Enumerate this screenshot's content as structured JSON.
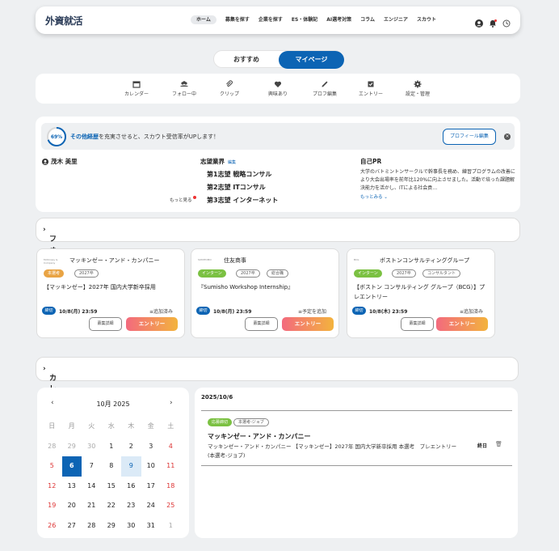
{
  "header": {
    "logo": "外資就活",
    "nav": [
      "ホーム",
      "募集を探す",
      "企業を探す",
      "ES・体験記",
      "AI選考対策",
      "コラム",
      "エンジニア",
      "スカウト"
    ]
  },
  "tabs": [
    "おすすめ",
    "マイページ"
  ],
  "menu": [
    {
      "label": "カレンダー",
      "icon": "calendar-icon"
    },
    {
      "label": "フォロー中",
      "icon": "people-icon"
    },
    {
      "label": "クリップ",
      "icon": "clip-icon"
    },
    {
      "label": "興味あり",
      "icon": "heart-icon"
    },
    {
      "label": "プロフ編集",
      "icon": "pencil-icon"
    },
    {
      "label": "エントリー",
      "icon": "entry-icon"
    },
    {
      "label": "設定・管理",
      "icon": "gear-icon"
    }
  ],
  "profile": {
    "percent": "69%",
    "percent_value": 0.69,
    "msg_bold": "その他経歴",
    "msg_rest": "を充実させると、スカウト受信率がUPします！",
    "button": "プロフィール編集",
    "name": "茂木 美里",
    "motto": "もっと見る",
    "pref_title": "志望業界",
    "pref_edit": "編集",
    "wishes": [
      "第1志望 戦略コンサル",
      "第2志望 ITコンサル",
      "第3志望 インターネット"
    ],
    "pr_title": "自己PR",
    "pr_text": "大学のバトミントンサークルで幹事長を務め、練習プログラムの改善により大会出場率を前年比120%に向上させました。活動で培った課題解決能力を活かし、ITによる社会貢…",
    "pr_more": "もっとみる"
  },
  "follow_title": "フォロー企業の募集",
  "jobs": [
    {
      "company": "マッキンゼー・アンド・カンパニー",
      "logo": "McKinsey & Company",
      "pills": [
        "本選考",
        "2027卒"
      ],
      "title": "【マッキンゼー】2027年 国内大学新卒採用",
      "deadline": "締切",
      "date": "10/8(月) 23:59",
      "status": "追加済み",
      "detail": "募集詳細",
      "entry": "エントリー"
    },
    {
      "company": "住友商事",
      "logo": "SUMITOMO",
      "pills": [
        "インターン",
        "2027卒",
        "総合職"
      ],
      "title": "『Sumisho Workshop Internship』",
      "deadline": "締切",
      "date": "10/8(月) 23:59",
      "status": "予定を追加",
      "detail": "募集詳細",
      "entry": "エントリー"
    },
    {
      "company": "ボストンコンサルティンググループ",
      "logo": "BCG",
      "pills": [
        "インターン",
        "2027卒",
        "コンサルタント"
      ],
      "title": "【ボストン コンサルティング グループ（BCG）】プレエントリー",
      "deadline": "締切",
      "date": "10/8(木) 23:59",
      "status": "追加済み",
      "detail": "募集詳細",
      "entry": "エントリー"
    }
  ],
  "calendar_title": "カレンダー",
  "calendar": {
    "month": "10月 2025",
    "weekdays": [
      "日",
      "月",
      "火",
      "水",
      "木",
      "金",
      "土"
    ],
    "weeks": [
      [
        "28",
        "29",
        "30",
        "1",
        "2",
        "3",
        "4"
      ],
      [
        "5",
        "6",
        "7",
        "8",
        "9",
        "10",
        "11"
      ],
      [
        "12",
        "13",
        "14",
        "15",
        "16",
        "17",
        "18"
      ],
      [
        "19",
        "20",
        "21",
        "22",
        "23",
        "24",
        "25"
      ],
      [
        "26",
        "27",
        "28",
        "29",
        "30",
        "31",
        "1"
      ]
    ],
    "selected": "6",
    "today": "9"
  },
  "event": {
    "date": "2025/10/6",
    "pills": [
      "応募締切",
      "本選考-ジョブ"
    ],
    "company": "マッキンゼー・アンド・カンパニー",
    "desc": "マッキンゼー・アンド・カンパニー 【マッキンゼー】2027年 国内大学新卒採用 本選考　プレエントリー",
    "tag": "終日",
    "sub": "(本選考-ジョブ)"
  },
  "colors": {
    "accent": "#0c64b4",
    "green": "#7bc142",
    "orange": "#e9a444",
    "red": "#d33"
  }
}
